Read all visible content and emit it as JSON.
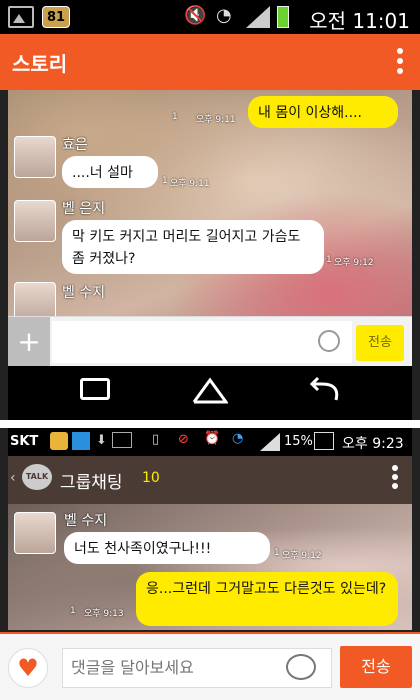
{
  "status_bar": {
    "badge": "81",
    "time": "오전 11:01",
    "icons": [
      "gallery-icon",
      "mute-icon",
      "wifi-icon",
      "signal-icon",
      "battery-icon"
    ]
  },
  "header": {
    "title": "스토리",
    "menu_icon": "more-vertical-icon",
    "accent_color": "#f15a24"
  },
  "screenshot1": {
    "messages": [
      {
        "sender": "",
        "text": "내 몸이 이상해....",
        "time": "오후 9:11",
        "unread": "1",
        "side": "right"
      },
      {
        "sender": "효은",
        "text": "....너 설마",
        "time": "오후 9:11",
        "unread": "1",
        "side": "left"
      },
      {
        "sender": "벨 은지",
        "text": "막 키도 커지고 머리도 길어지고 가슴도 좀 커졌나?",
        "time": "오후 9:12",
        "unread": "1",
        "side": "left"
      },
      {
        "sender": "벨 수지",
        "text": "",
        "time": "",
        "unread": "",
        "side": "left"
      }
    ],
    "input": {
      "plus": "+",
      "send": "전송"
    },
    "nav": [
      "recent-apps-icon",
      "home-icon",
      "back-icon"
    ]
  },
  "screenshot2": {
    "status": {
      "carrier": "SKT",
      "battery_percent": "15%",
      "time": "오후 9:23"
    },
    "chat_title": "그룹채팅",
    "member_count": "10",
    "app_badge": "TALK",
    "messages": [
      {
        "sender": "벨 수지",
        "text": "너도 천사족이였구나!!!",
        "time": "오후 9:12",
        "unread": "1",
        "side": "left"
      },
      {
        "sender": "",
        "text": "응...그런데 그거말고도 다른것도 있는데?",
        "time": "오후 9:13",
        "unread": "1",
        "side": "right"
      }
    ]
  },
  "comment_bar": {
    "like_icon": "heart-icon",
    "placeholder": "댓글을 달아보세요",
    "emoji_icon": "emoticon-icon",
    "send": "전송"
  }
}
